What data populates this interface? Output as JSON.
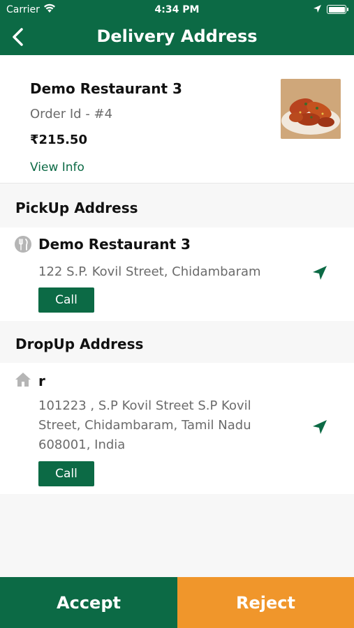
{
  "status_bar": {
    "carrier": "Carrier",
    "time": "4:34 PM"
  },
  "header": {
    "title": "Delivery Address",
    "back_icon": "chevron-left-icon"
  },
  "order": {
    "restaurant_name": "Demo Restaurant 3",
    "order_id": "Order Id - #4",
    "price": "₹215.50",
    "view_info_label": "View Info"
  },
  "pickup": {
    "heading": "PickUp Address",
    "name": "Demo Restaurant 3",
    "address": "122 S.P. Kovil Street, Chidambaram",
    "call_label": "Call",
    "icon": "restaurant-icon"
  },
  "dropoff": {
    "heading": "DropUp Address",
    "name": "r",
    "address": "101223 , S.P Kovil Street S.P Kovil Street, Chidambaram, Tamil Nadu 608001, India",
    "call_label": "Call",
    "icon": "home-icon"
  },
  "actions": {
    "accept_label": "Accept",
    "reject_label": "Reject"
  },
  "colors": {
    "primary": "#0c6a45",
    "reject": "#f0962b",
    "background": "#f7f7f7"
  }
}
